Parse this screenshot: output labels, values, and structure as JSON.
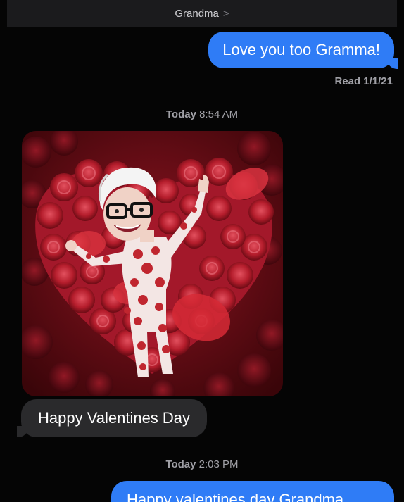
{
  "header": {
    "contact_name": "Grandma",
    "chevron": ">"
  },
  "messages": {
    "sent_1": "Love you too Gramma!",
    "read_receipt": "Read 1/1/21",
    "timestamp_1_day": "Today",
    "timestamp_1_time": "8:54 AM",
    "received_1": "Happy Valentines Day",
    "timestamp_2_day": "Today",
    "timestamp_2_time": "2:03 PM",
    "sent_2": "Happy valentines day Grandma"
  },
  "colors": {
    "sent_bubble": "#2f7cf6",
    "received_bubble": "#2a2a2c",
    "background": "#050505",
    "roses": "#b51d2c"
  },
  "icons": {
    "header_chevron": "chevron-right-icon"
  }
}
